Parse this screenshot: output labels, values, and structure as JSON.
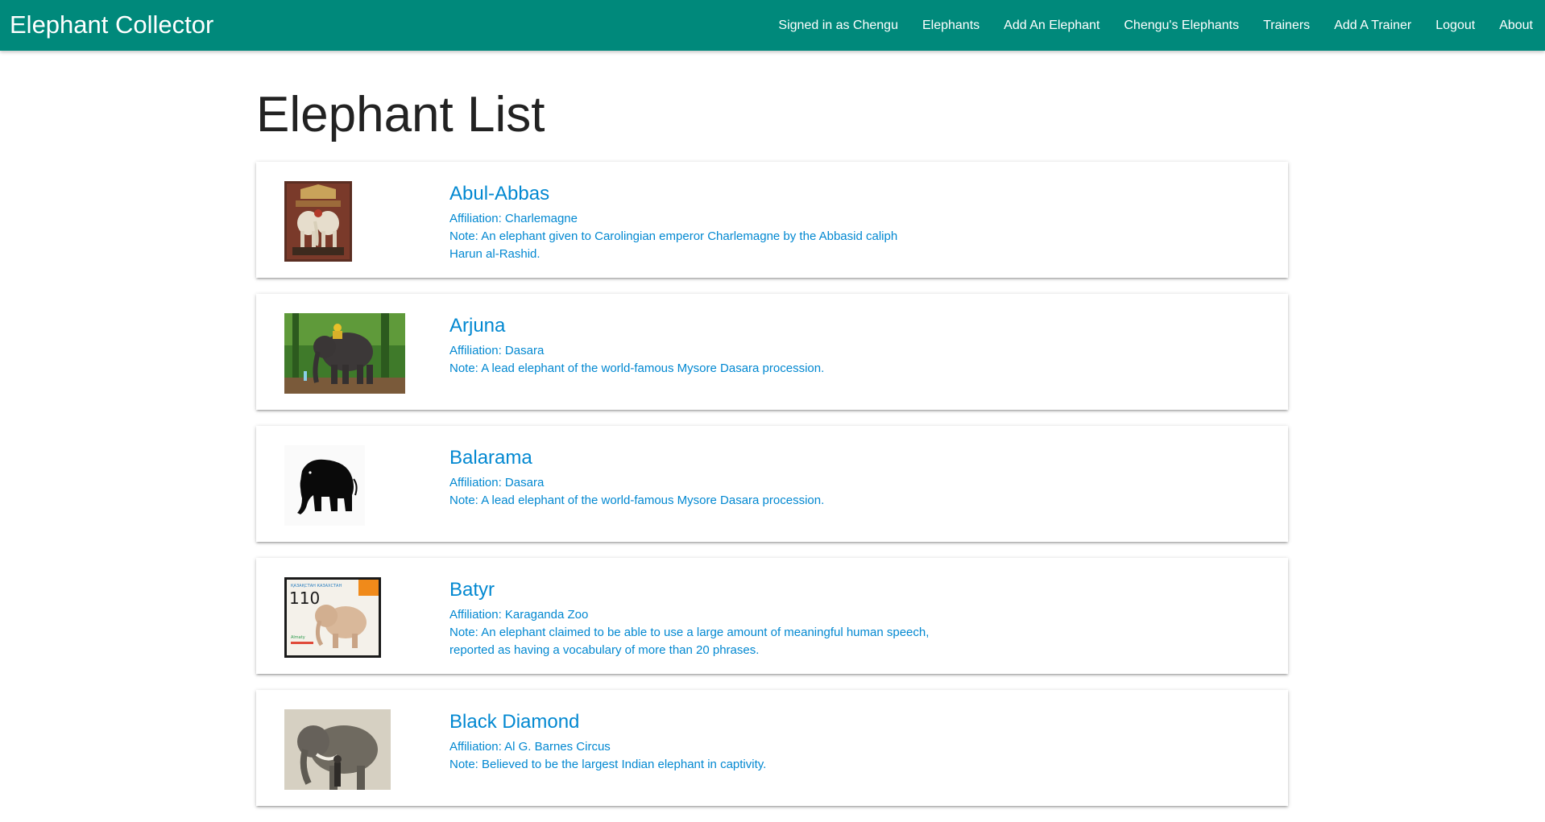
{
  "header": {
    "brand": "Elephant Collector",
    "signed_in": "Signed in as Chengu",
    "nav": [
      "Elephants",
      "Add An Elephant",
      "Chengu's Elephants",
      "Trainers",
      "Add A Trainer",
      "Logout",
      "About"
    ]
  },
  "main": {
    "title": "Elephant List",
    "elephants": [
      {
        "name": "Abul-Abbas",
        "affiliation": "Affiliation: Charlemagne",
        "note": "Note: An elephant given to Carolingian emperor Charlemagne by the Abbasid caliph Harun al-Rashid."
      },
      {
        "name": "Arjuna",
        "affiliation": "Affiliation: Dasara",
        "note": "Note: A lead elephant of the world-famous Mysore Dasara procession."
      },
      {
        "name": "Balarama",
        "affiliation": "Affiliation: Dasara",
        "note": "Note: A lead elephant of the world-famous Mysore Dasara procession."
      },
      {
        "name": "Batyr",
        "affiliation": "Affiliation: Karaganda Zoo",
        "note": "Note: An elephant claimed to be able to use a large amount of meaningful human speech, reported as having a vocabulary of more than 20 phrases."
      },
      {
        "name": "Black Diamond",
        "affiliation": "Affiliation: Al G. Barnes Circus",
        "note": "Note: Believed to be the largest Indian elephant in captivity."
      }
    ],
    "stamp": {
      "value": "110",
      "country": "ҚАЗАҚСТАН КАЗАХСТАН",
      "place": "Almaty"
    }
  },
  "colors": {
    "navbar": "#00897b",
    "link": "#0288d1"
  }
}
